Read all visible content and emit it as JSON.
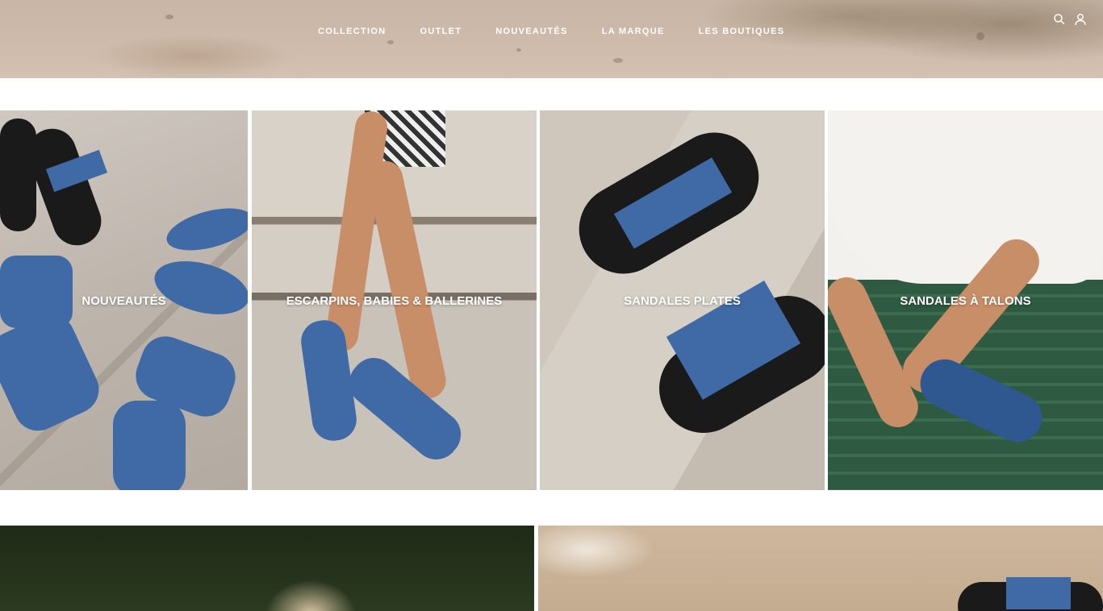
{
  "nav": {
    "items": [
      "COLLECTION",
      "OUTLET",
      "NOUVEAUTÉS",
      "LA MARQUE",
      "LES BOUTIQUES"
    ]
  },
  "header_icons": [
    "search-icon",
    "user-icon"
  ],
  "tiles": [
    {
      "label": "NOUVEAUTÉS"
    },
    {
      "label": "ESCARPINS, BABIES & BALLERINES"
    },
    {
      "label": "SANDALES PLATES"
    },
    {
      "label": "SANDALES À TALONS"
    }
  ]
}
